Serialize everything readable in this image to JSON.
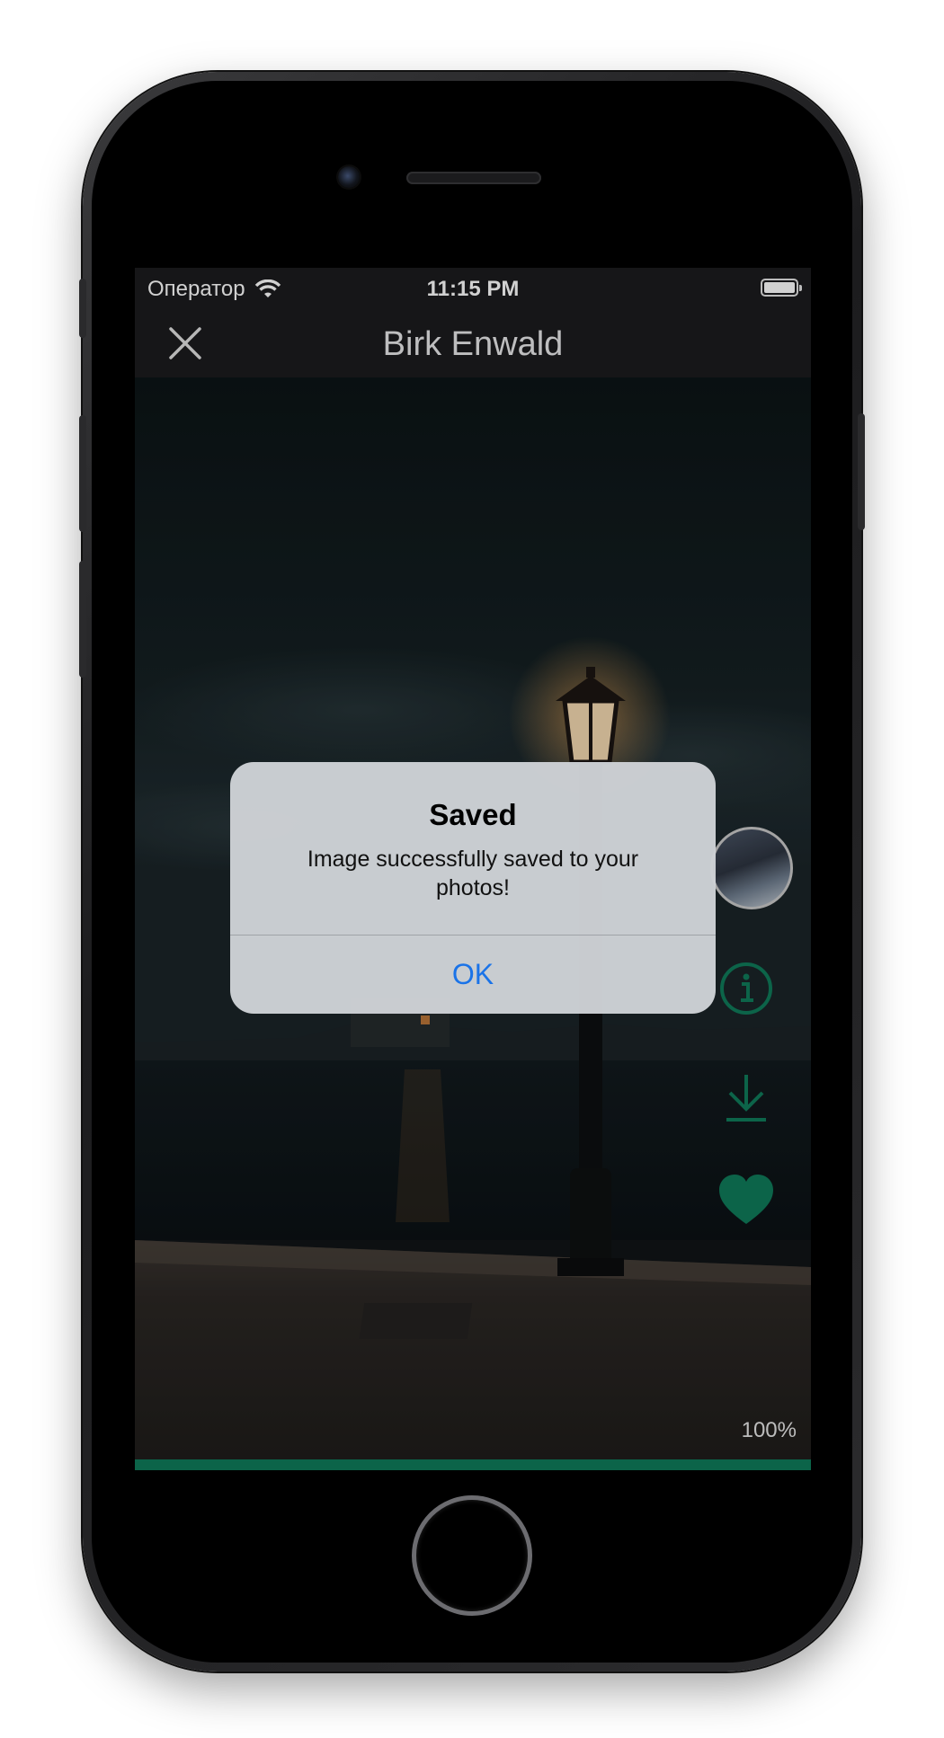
{
  "status_bar": {
    "carrier": "Оператор",
    "time": "11:15 PM"
  },
  "nav": {
    "title": "Birk Enwald"
  },
  "viewer": {
    "zoom_label": "100%",
    "load_progress": 1.0
  },
  "actions": {
    "icons": [
      "user-avatar",
      "info-icon",
      "download-icon",
      "heart-icon"
    ]
  },
  "alert": {
    "title": "Saved",
    "message": "Image successfully saved to your photos!",
    "ok_label": "OK"
  },
  "colors": {
    "accent_green": "#0f7a5a",
    "alert_button_blue": "#1a73e8",
    "nav_background": "#1c1c1e"
  }
}
